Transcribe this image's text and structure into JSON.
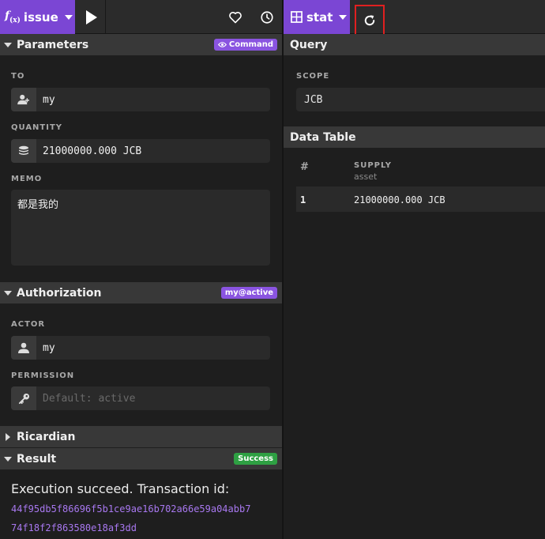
{
  "toolbar": {
    "action_label": "issue",
    "action_prefix": "f",
    "action_sub": "(x)",
    "table_label": "stat"
  },
  "parameters": {
    "header": "Parameters",
    "badge": "Command",
    "to_label": "TO",
    "to_value": "my",
    "quantity_label": "QUANTITY",
    "quantity_value": "21000000.000 JCB",
    "memo_label": "MEMO",
    "memo_value": "都是我的"
  },
  "authorization": {
    "header": "Authorization",
    "badge": "my@active",
    "actor_label": "ACTOR",
    "actor_value": "my",
    "permission_label": "PERMISSION",
    "permission_placeholder": "Default: active"
  },
  "ricardian": {
    "header": "Ricardian"
  },
  "result": {
    "header": "Result",
    "badge": "Success",
    "message": "Execution succeed. Transaction id:",
    "txid_line1": "44f95db5f86696f5b1ce9ae16b702a66e59a04abb7",
    "txid_line2": "74f18f2f863580e18af3dd"
  },
  "query": {
    "header": "Query",
    "scope_label": "SCOPE",
    "scope_value": "JCB"
  },
  "data_table": {
    "header": "Data Table",
    "columns": [
      {
        "label": "#",
        "type": ""
      },
      {
        "label": "SUPPLY",
        "type": "asset"
      }
    ],
    "rows": [
      {
        "index": "1",
        "supply": "21000000.000 JCB"
      }
    ]
  },
  "icons": {
    "favorite": "heart-icon",
    "history": "clock-icon",
    "refresh": "refresh-icon",
    "table": "table-icon"
  },
  "colors": {
    "accent": "#7b46d4",
    "success": "#2ea043",
    "txid": "#a878f0",
    "highlight": "#e02020"
  }
}
